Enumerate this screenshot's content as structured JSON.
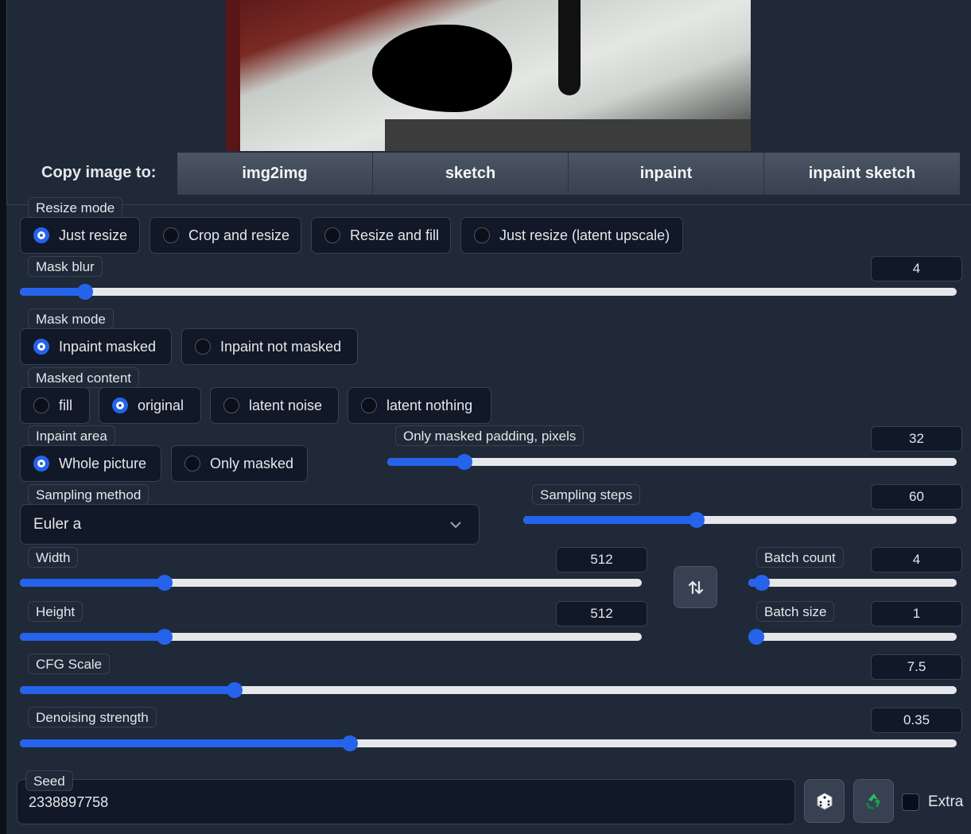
{
  "copy": {
    "label": "Copy image to:",
    "buttons": [
      "img2img",
      "sketch",
      "inpaint",
      "inpaint sketch"
    ]
  },
  "resize_mode": {
    "label": "Resize mode",
    "options": [
      "Just resize",
      "Crop and resize",
      "Resize and fill",
      "Just resize (latent upscale)"
    ],
    "selected": "Just resize"
  },
  "mask_blur": {
    "label": "Mask blur",
    "value": "4",
    "min": 0,
    "max": 64
  },
  "mask_mode": {
    "label": "Mask mode",
    "options": [
      "Inpaint masked",
      "Inpaint not masked"
    ],
    "selected": "Inpaint masked"
  },
  "masked_content": {
    "label": "Masked content",
    "options": [
      "fill",
      "original",
      "latent noise",
      "latent nothing"
    ],
    "selected": "original"
  },
  "inpaint_area": {
    "label": "Inpaint area",
    "options": [
      "Whole picture",
      "Only masked"
    ],
    "selected": "Whole picture"
  },
  "only_masked_padding": {
    "label": "Only masked padding, pixels",
    "value": "32",
    "min": 0,
    "max": 256
  },
  "sampling_method": {
    "label": "Sampling method",
    "value": "Euler a"
  },
  "sampling_steps": {
    "label": "Sampling steps",
    "value": "60",
    "min": 1,
    "max": 150
  },
  "width": {
    "label": "Width",
    "value": "512",
    "min": 64,
    "max": 2048
  },
  "height": {
    "label": "Height",
    "value": "512",
    "min": 64,
    "max": 2048
  },
  "batch_count": {
    "label": "Batch count",
    "value": "4",
    "min": 1,
    "max": 100
  },
  "batch_size": {
    "label": "Batch size",
    "value": "1",
    "min": 1,
    "max": 8
  },
  "cfg_scale": {
    "label": "CFG Scale",
    "value": "7.5",
    "min": 1,
    "max": 30
  },
  "denoising_strength": {
    "label": "Denoising strength",
    "value": "0.35",
    "min": 0,
    "max": 1
  },
  "seed": {
    "label": "Seed",
    "value": "2338897758"
  },
  "extra": {
    "label": "Extra",
    "checked": false
  },
  "icons": {
    "swap": "swap-vertical-arrows-icon",
    "random": "dice-icon",
    "reuse": "recycle-icon",
    "chevron": "chevron-down-icon"
  },
  "colors": {
    "accent": "#2563eb",
    "panel": "#1f2937",
    "input": "#111827"
  }
}
